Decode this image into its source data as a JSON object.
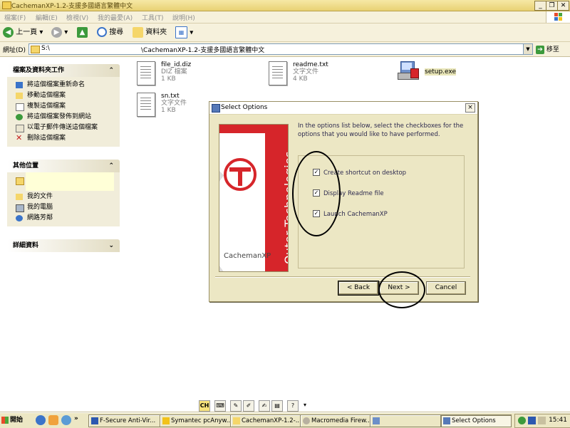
{
  "window": {
    "title": "CachemanXP-1.2-支援多國語言繁體中文",
    "controls": [
      "_",
      "❐",
      "✕"
    ]
  },
  "menu": [
    "檔案(F)",
    "編輯(E)",
    "檢視(V)",
    "我的最愛(A)",
    "工具(T)",
    "說明(H)"
  ],
  "toolbar": {
    "back": "上一頁",
    "search": "搜尋",
    "folders": "資料夾"
  },
  "address": {
    "label": "網址(D)",
    "drive": "S:\\",
    "path": "\\CachemanXP-1.2-支援多國語言繁體中文",
    "go": "移至"
  },
  "leftpane": {
    "tasks": {
      "title": "檔案及資料夾工作",
      "items": [
        "將這個檔案重新命名",
        "移動這個檔案",
        "複製這個檔案",
        "將這個檔案發佈到網站",
        "以電子郵件傳送這個檔案",
        "刪除這個檔案"
      ]
    },
    "places": {
      "title": "其他位置",
      "items": [
        "我的文件",
        "我的電腦",
        "網路芳鄰"
      ]
    },
    "details": {
      "title": "詳細資料"
    }
  },
  "files": [
    {
      "name": "file_id.diz",
      "type": "DIZ 檔案",
      "size": "1 KB"
    },
    {
      "name": "readme.txt",
      "type": "文字文件",
      "size": "4 KB"
    },
    {
      "name": "setup.exe",
      "type": "",
      "size": ""
    },
    {
      "name": "sn.txt",
      "type": "文字文件",
      "size": "1 KB"
    }
  ],
  "dialog": {
    "title": "Select Options",
    "close": "×",
    "intro": "In the options list below, select the checkboxes for the options that you would like to have performed.",
    "banner_vertical": "Outer Technologies",
    "banner_logo": "CachemanXP",
    "options": [
      {
        "label": "Create shortcut on desktop",
        "checked": true
      },
      {
        "label": "Display Readme file",
        "checked": true
      },
      {
        "label": "Launch CachemanXP",
        "checked": true
      }
    ],
    "buttons": {
      "back": "< Back",
      "next": "Next >",
      "cancel": "Cancel"
    }
  },
  "langbar": {
    "lang": "CH"
  },
  "taskbar": {
    "start": "開始",
    "tasks": [
      "F-Secure Anti-Vir...",
      "Symantec pcAnyw...",
      "CachemanXP-1.2-...",
      "Macromedia Firew...",
      "",
      "Select Options"
    ],
    "clock": "15:41"
  },
  "colors": {
    "banner_red": "#d6252a",
    "dialog_bg": "#ece7c4",
    "titlebar": "#f0dd8a"
  }
}
